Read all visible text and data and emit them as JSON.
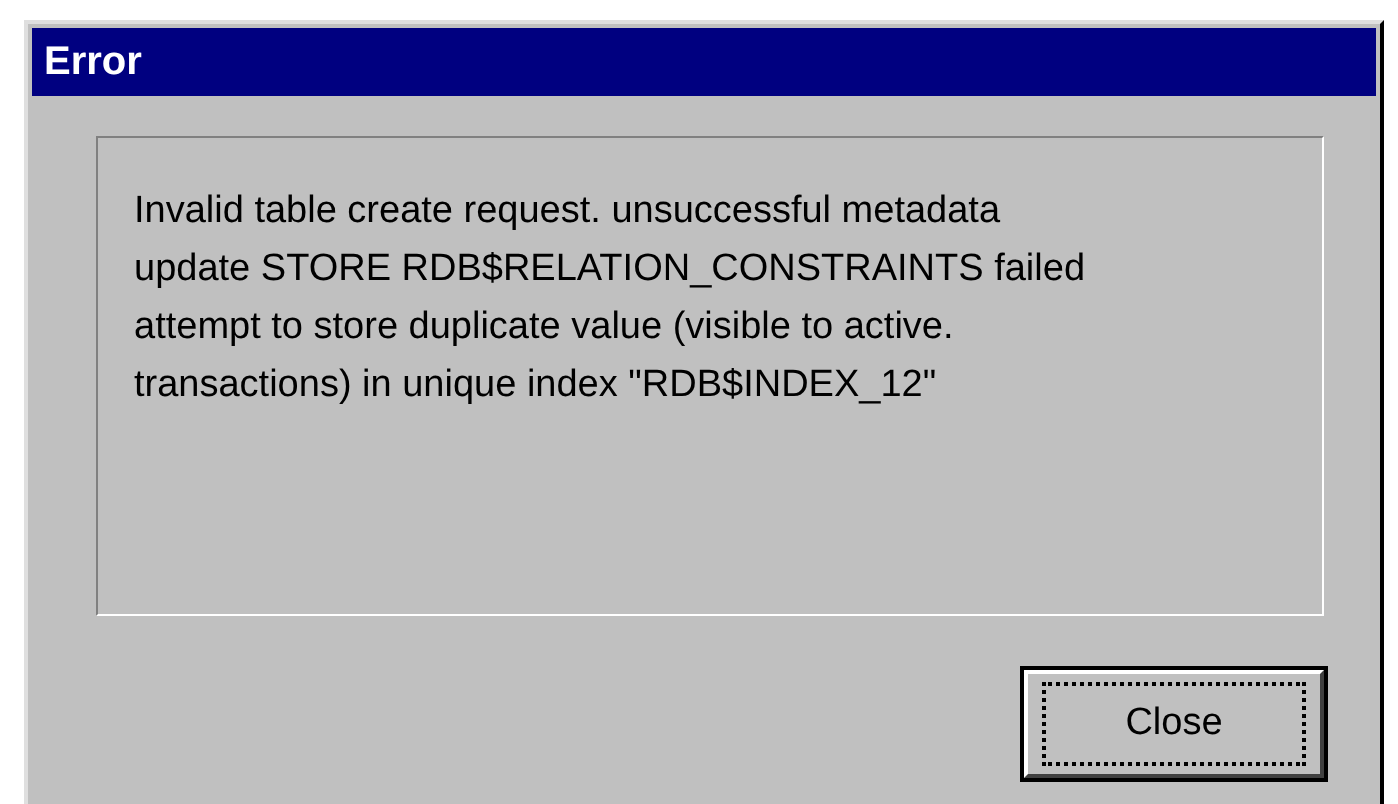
{
  "window": {
    "title": "Error"
  },
  "message": {
    "lines": [
      "Invalid table create request. unsuccessful metadata",
      "update STORE RDB$RELATION_CONSTRAINTS failed",
      "attempt to store duplicate value (visible to active.",
      "transactions) in unique index \"RDB$INDEX_12\""
    ]
  },
  "buttons": [
    {
      "label": "Close",
      "focused": true
    }
  ]
}
